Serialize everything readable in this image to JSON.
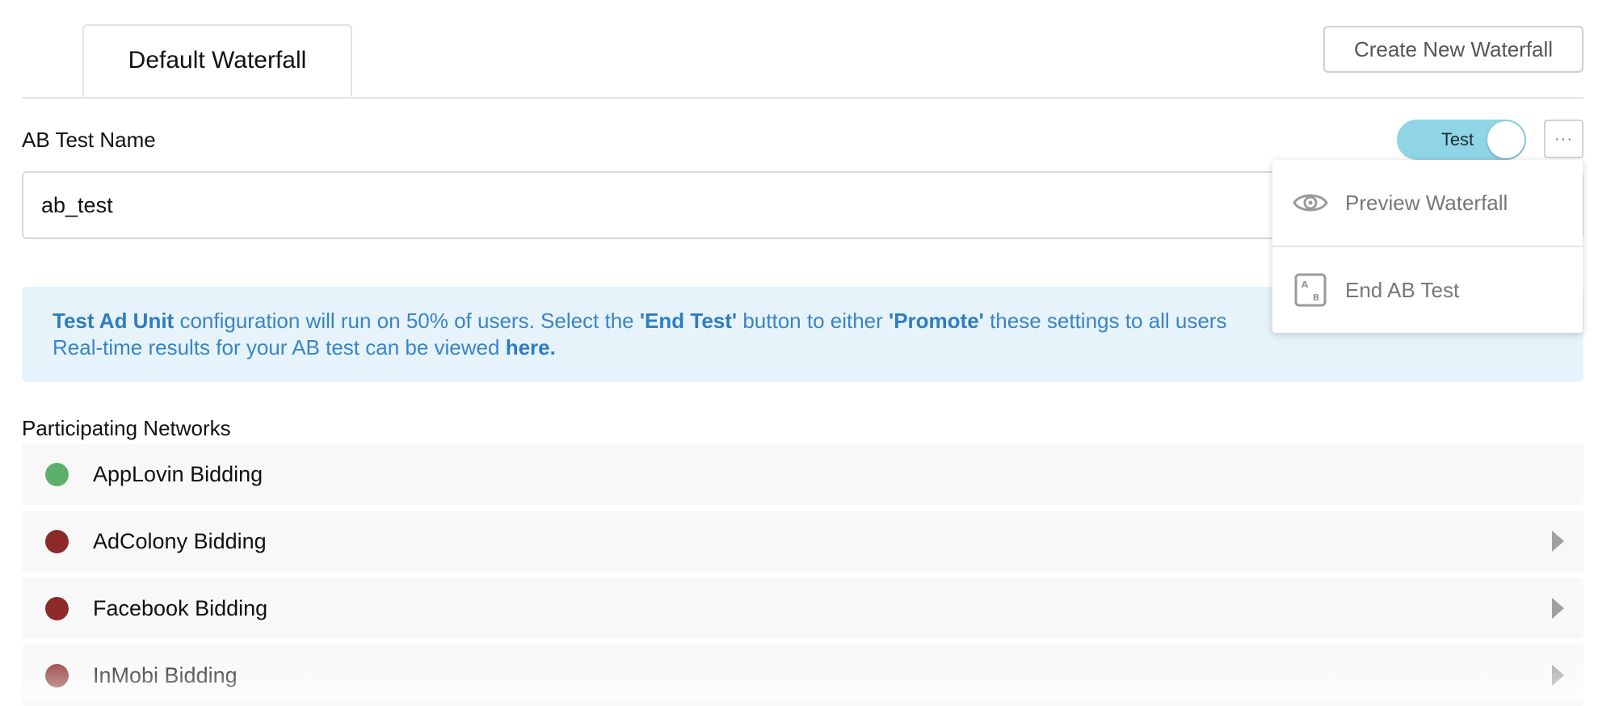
{
  "tabs": {
    "active_label": "Default Waterfall"
  },
  "header": {
    "create_button_label": "Create New Waterfall"
  },
  "ab_test": {
    "name_label": "AB Test Name",
    "name_value": "ab_test",
    "toggle_label": "Test",
    "more_label": "···"
  },
  "info_banner": {
    "part1_bold": "Test Ad Unit",
    "part2": " configuration will run on 50% of users. Select the ",
    "part3_bold": "'End Test'",
    "part4": " button to either ",
    "part5_bold": "'Promote'",
    "part6": " these settings to all users",
    "line2": "Real-time results for your AB test can be viewed ",
    "link": "here."
  },
  "networks": {
    "label": "Participating Networks",
    "items": [
      {
        "name": "AppLovin Bidding",
        "status_color": "#5bb06e",
        "expandable": false
      },
      {
        "name": "AdColony Bidding",
        "status_color": "#8c2a2a",
        "expandable": true
      },
      {
        "name": "Facebook Bidding",
        "status_color": "#8c2a2a",
        "expandable": true
      },
      {
        "name": "InMobi Bidding",
        "status_color": "#8c2a2a",
        "expandable": true
      }
    ]
  },
  "menu": {
    "items": [
      {
        "label": "Preview Waterfall",
        "icon": "eye-icon"
      },
      {
        "label": "End AB Test",
        "icon": "ab-test-icon"
      }
    ]
  },
  "colors": {
    "toggle_on": "#8fd5e6",
    "banner_bg": "#e6f3fb",
    "banner_text": "#3a84c4"
  }
}
